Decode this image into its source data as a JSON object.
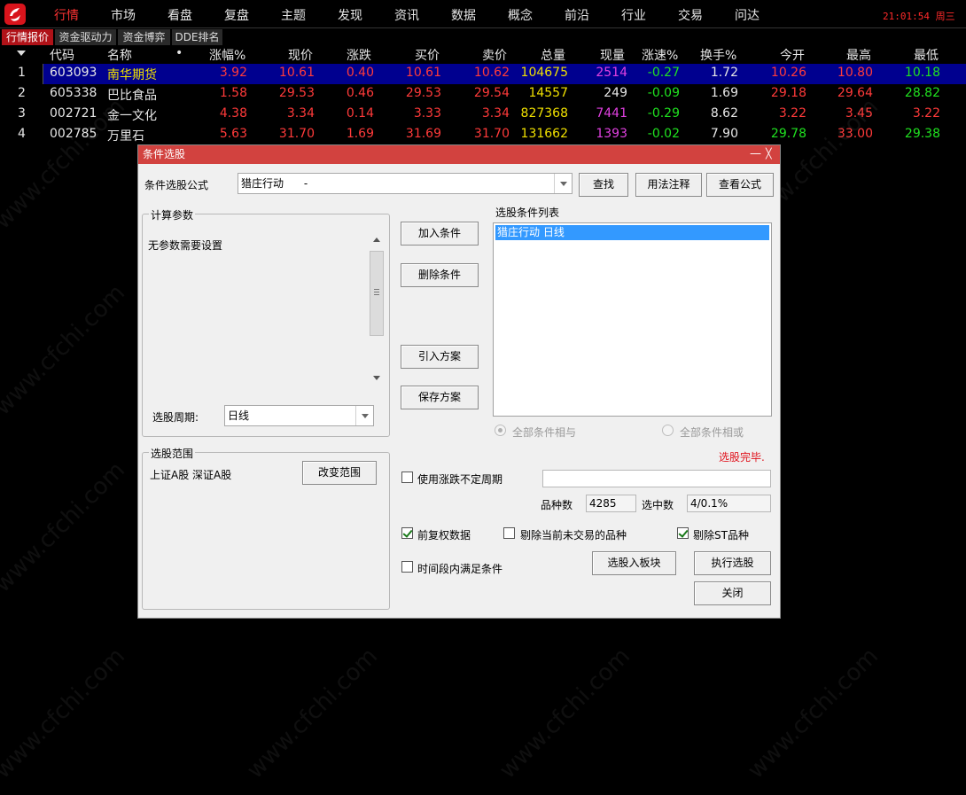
{
  "menu": {
    "items": [
      "行情",
      "市场",
      "看盘",
      "复盘",
      "主题",
      "发现",
      "资讯",
      "数据",
      "概念",
      "前沿",
      "行业",
      "交易",
      "问达"
    ],
    "active": "行情",
    "clock": "21:01:54 周三"
  },
  "subtabs": [
    "行情报价",
    "资金驱动力",
    "资金博弈",
    "DDE排名"
  ],
  "quote_table": {
    "headers": [
      "代码",
      "名称",
      "•",
      "涨幅%",
      "现价",
      "涨跌",
      "买价",
      "卖价",
      "总量",
      "现量",
      "涨速%",
      "换手%",
      "今开",
      "最高",
      "最低"
    ],
    "rows": [
      {
        "idx": "1",
        "code": "603093",
        "name": "南华期货",
        "pct": "3.92",
        "price": "10.61",
        "chg": "0.40",
        "bid": "10.61",
        "ask": "10.62",
        "vol": "104675",
        "cur": "2514",
        "speed": "-0.27",
        "turn": "1.72",
        "open": "10.26",
        "high": "10.80",
        "low": "10.18"
      },
      {
        "idx": "2",
        "code": "605338",
        "name": "巴比食品",
        "pct": "1.58",
        "price": "29.53",
        "chg": "0.46",
        "bid": "29.53",
        "ask": "29.54",
        "vol": "14557",
        "cur": "249",
        "speed": "-0.09",
        "turn": "1.69",
        "open": "29.18",
        "high": "29.64",
        "low": "28.82"
      },
      {
        "idx": "3",
        "code": "002721",
        "name": "金一文化",
        "pct": "4.38",
        "price": "3.34",
        "chg": "0.14",
        "bid": "3.33",
        "ask": "3.34",
        "vol": "827368",
        "cur": "7441",
        "speed": "-0.29",
        "turn": "8.62",
        "open": "3.22",
        "high": "3.45",
        "low": "3.22"
      },
      {
        "idx": "4",
        "code": "002785",
        "name": "万里石",
        "pct": "5.63",
        "price": "31.70",
        "chg": "1.69",
        "bid": "31.69",
        "ask": "31.70",
        "vol": "131662",
        "cur": "1393",
        "speed": "-0.02",
        "turn": "7.90",
        "open": "29.78",
        "high": "33.00",
        "low": "29.38"
      }
    ]
  },
  "dialog": {
    "title": "条件选股",
    "min_glyph": "—",
    "close_glyph": "╳",
    "formula_label": "条件选股公式",
    "formula_value": "猎庄行动      -",
    "buttons": {
      "find": "查找",
      "usage": "用法注释",
      "view_formula": "查看公式",
      "add_condition": "加入条件",
      "delete_condition": "删除条件",
      "import_plan": "引入方案",
      "save_plan": "保存方案",
      "change_range": "改变范围",
      "select_to_block": "选股入板块",
      "execute": "执行选股",
      "close": "关闭"
    },
    "params_group": "计算参数",
    "params_text": "无参数需要设置",
    "period_label": "选股周期:",
    "period_value": "日线",
    "range_group": "选股范围",
    "range_text": "上证A股 深证A股",
    "condition_list_label": "选股条件列表",
    "condition_items": [
      "猎庄行动  日线"
    ],
    "radio_and": "全部条件相与",
    "radio_or": "全部条件相或",
    "status": "选股完毕.",
    "use_uncertain_period": "使用涨跌不定周期",
    "count_label": "品种数",
    "count_value": "4285",
    "selected_label": "选中数",
    "selected_value": "4/0.1%",
    "forward_adjust": "前复权数据",
    "exclude_not_traded": "剔除当前未交易的品种",
    "exclude_st": "剔除ST品种",
    "period_satisfy": "时间段内满足条件"
  },
  "watermark": "www.cfchi.com"
}
